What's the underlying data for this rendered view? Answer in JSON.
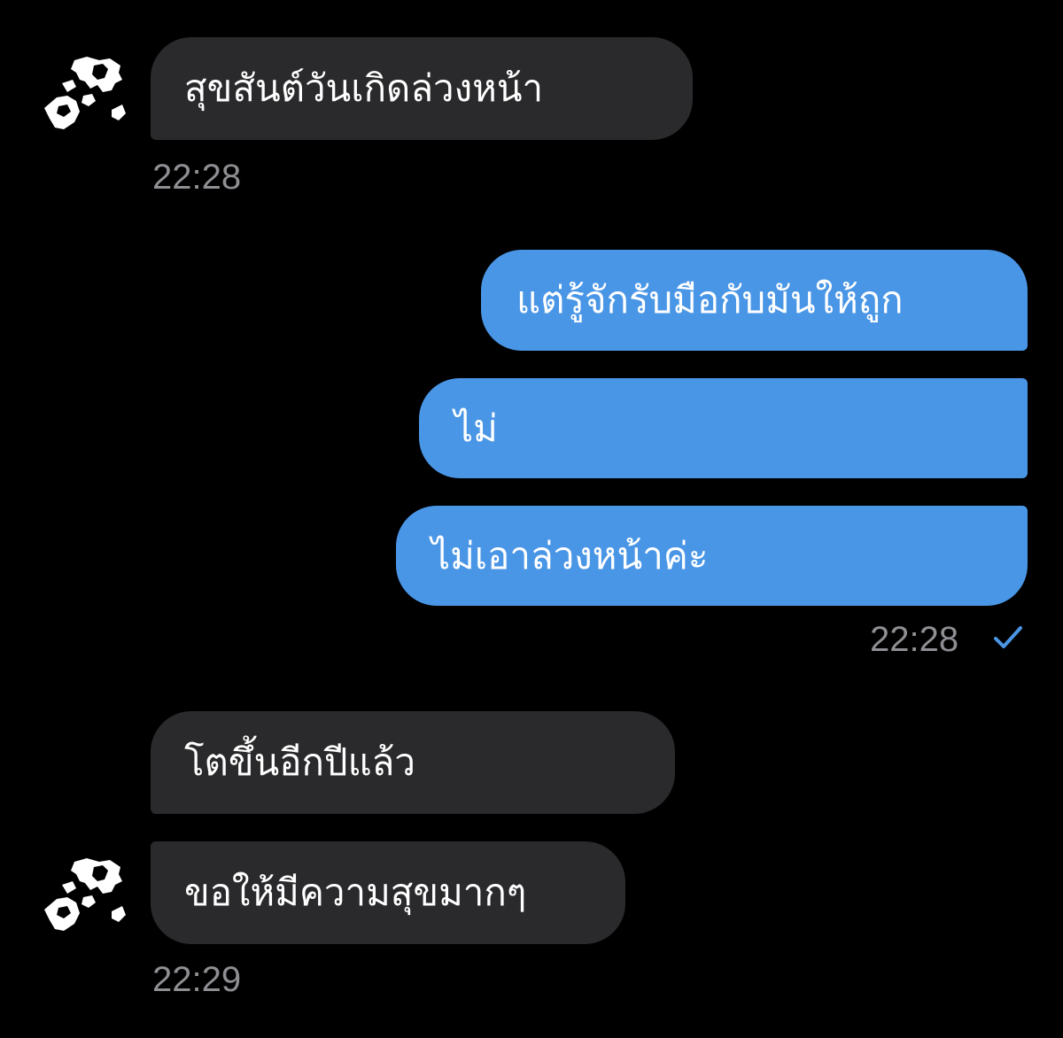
{
  "messages": [
    {
      "direction": "incoming",
      "text": "สุขสันต์วันเกิดล่วงหน้า"
    },
    {
      "direction": "outgoing",
      "text": "แต่รู้จักรับมือกับมันให้ถูก"
    },
    {
      "direction": "outgoing",
      "text": "ไม่"
    },
    {
      "direction": "outgoing",
      "text": "ไม่เอาล่วงหน้าค่ะ"
    },
    {
      "direction": "incoming",
      "text": "โตขึ้นอีกปีแล้ว"
    },
    {
      "direction": "incoming",
      "text": "ขอให้มีความสุขมากๆ"
    }
  ],
  "timestamps": {
    "group1": "22:28",
    "group2": "22:28",
    "group3": "22:29"
  },
  "status": {
    "read_icon": "check-icon",
    "check_color": "#4a96e6"
  },
  "colors": {
    "background": "#000000",
    "incoming_bubble": "#2a2a2c",
    "outgoing_bubble": "#4a96e6",
    "timestamp": "#8e8e93",
    "text": "#ffffff"
  },
  "avatar": {
    "icon": "contact-avatar"
  }
}
